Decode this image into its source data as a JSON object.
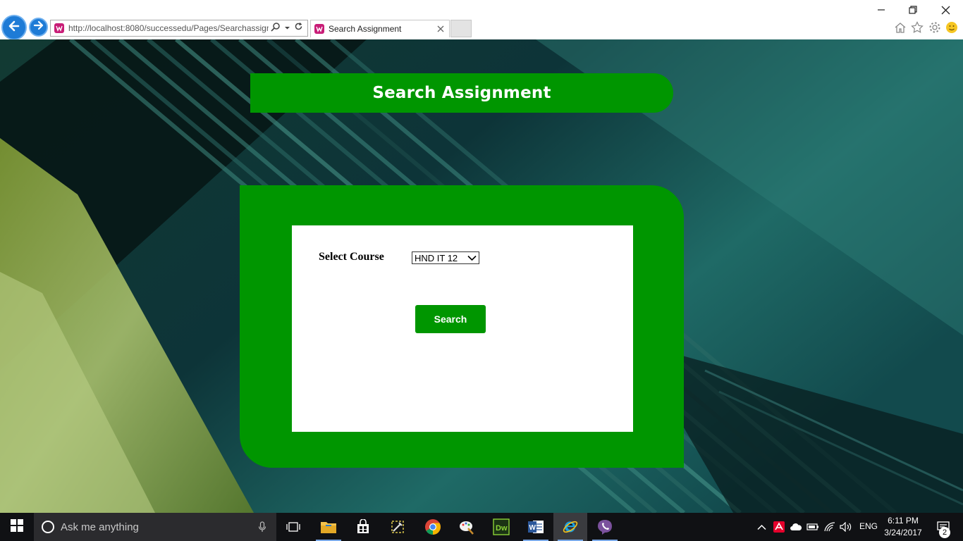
{
  "browser": {
    "url": "http://localhost:8080/successedu/Pages/Searchassign",
    "tab_title": "Search Assignment",
    "back_icon": "back-arrow-icon",
    "forward_icon": "forward-arrow-icon"
  },
  "page": {
    "title": "Search Assignment",
    "form": {
      "course_label": "Select Course",
      "course_selected": "HND IT 12",
      "search_button": "Search"
    }
  },
  "taskbar": {
    "search_placeholder": "Ask me anything",
    "language": "ENG",
    "time": "6:11 PM",
    "date": "3/24/2017",
    "notification_count": "2"
  },
  "colors": {
    "accent_green": "#009600",
    "browser_blue": "#1e7bd6",
    "taskbar": "#101114"
  }
}
